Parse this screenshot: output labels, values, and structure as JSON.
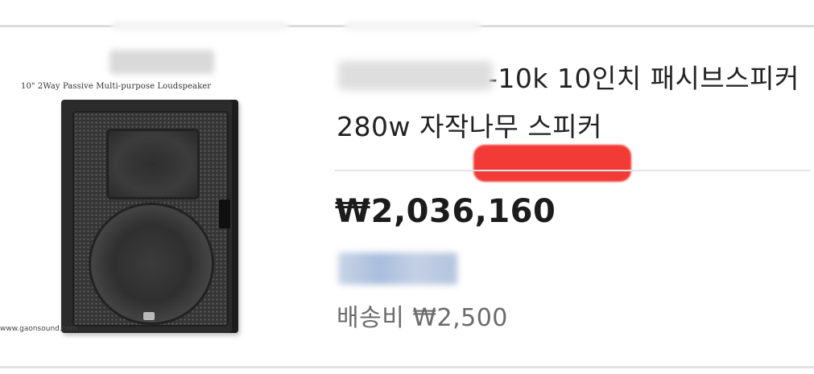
{
  "product": {
    "image": {
      "caption": "10\" 2Way Passive Multi-purpose Loudspeaker",
      "source_url": "www.gaonsound.com"
    },
    "title": "-10k 10인치 패시브스피커 280w 자작나무 스피커",
    "price": "₩2,036,160",
    "shipping": "배송비 ₩2,500"
  }
}
